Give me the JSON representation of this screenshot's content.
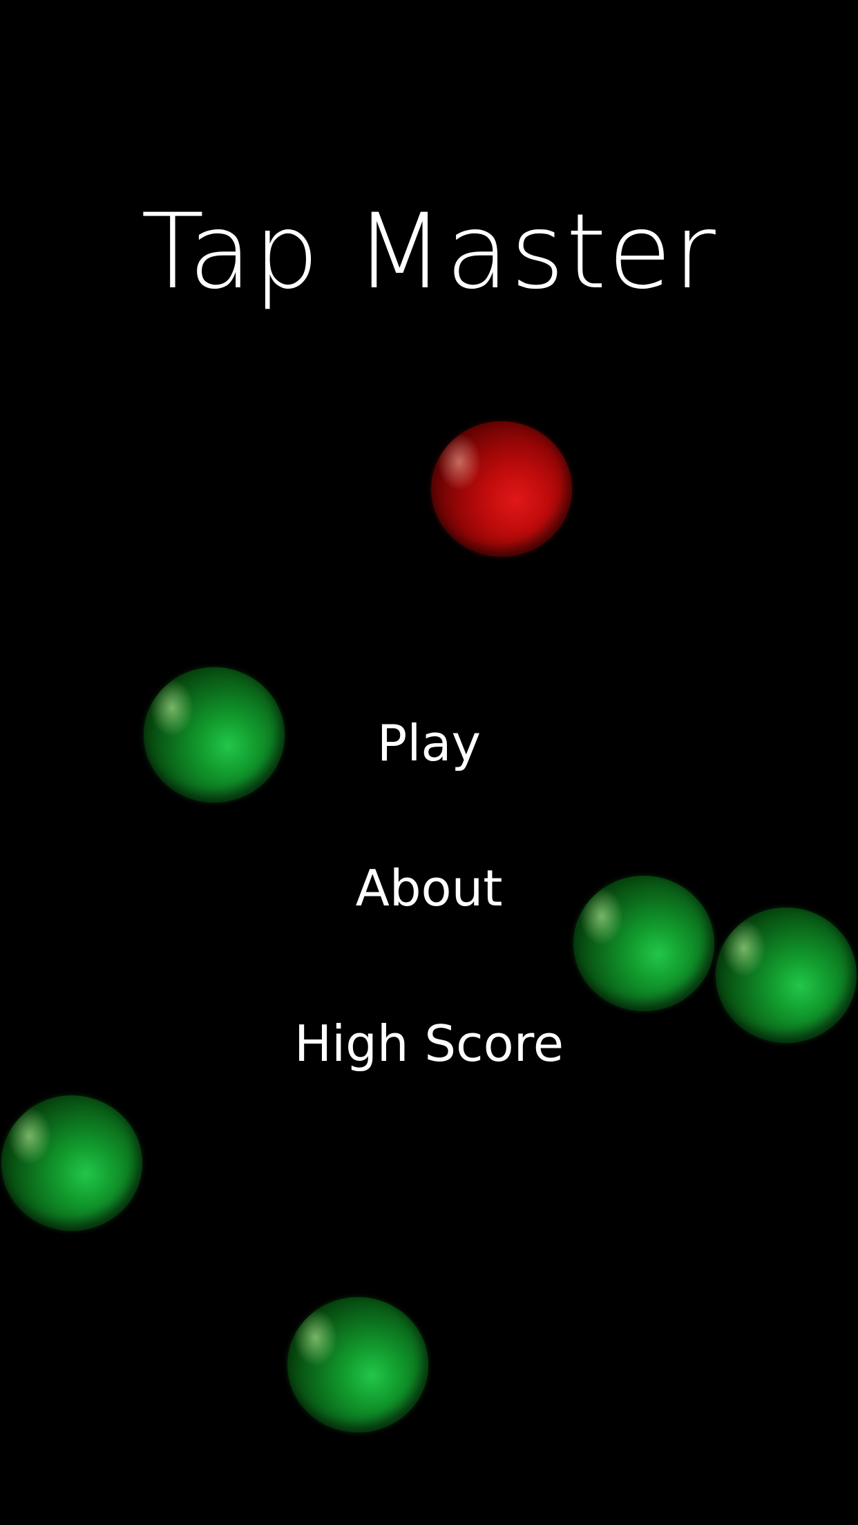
{
  "game": {
    "title": "Tap Master",
    "colors": {
      "background": "#000000",
      "text": "#ffffff",
      "target_ball": "#c81010",
      "decoy_ball": "#1aa83a"
    }
  },
  "menu": {
    "play_label": "Play",
    "about_label": "About",
    "high_score_label": "High Score"
  },
  "balls": [
    {
      "color": "red"
    },
    {
      "color": "green"
    },
    {
      "color": "green"
    },
    {
      "color": "green"
    },
    {
      "color": "green"
    },
    {
      "color": "green"
    }
  ]
}
